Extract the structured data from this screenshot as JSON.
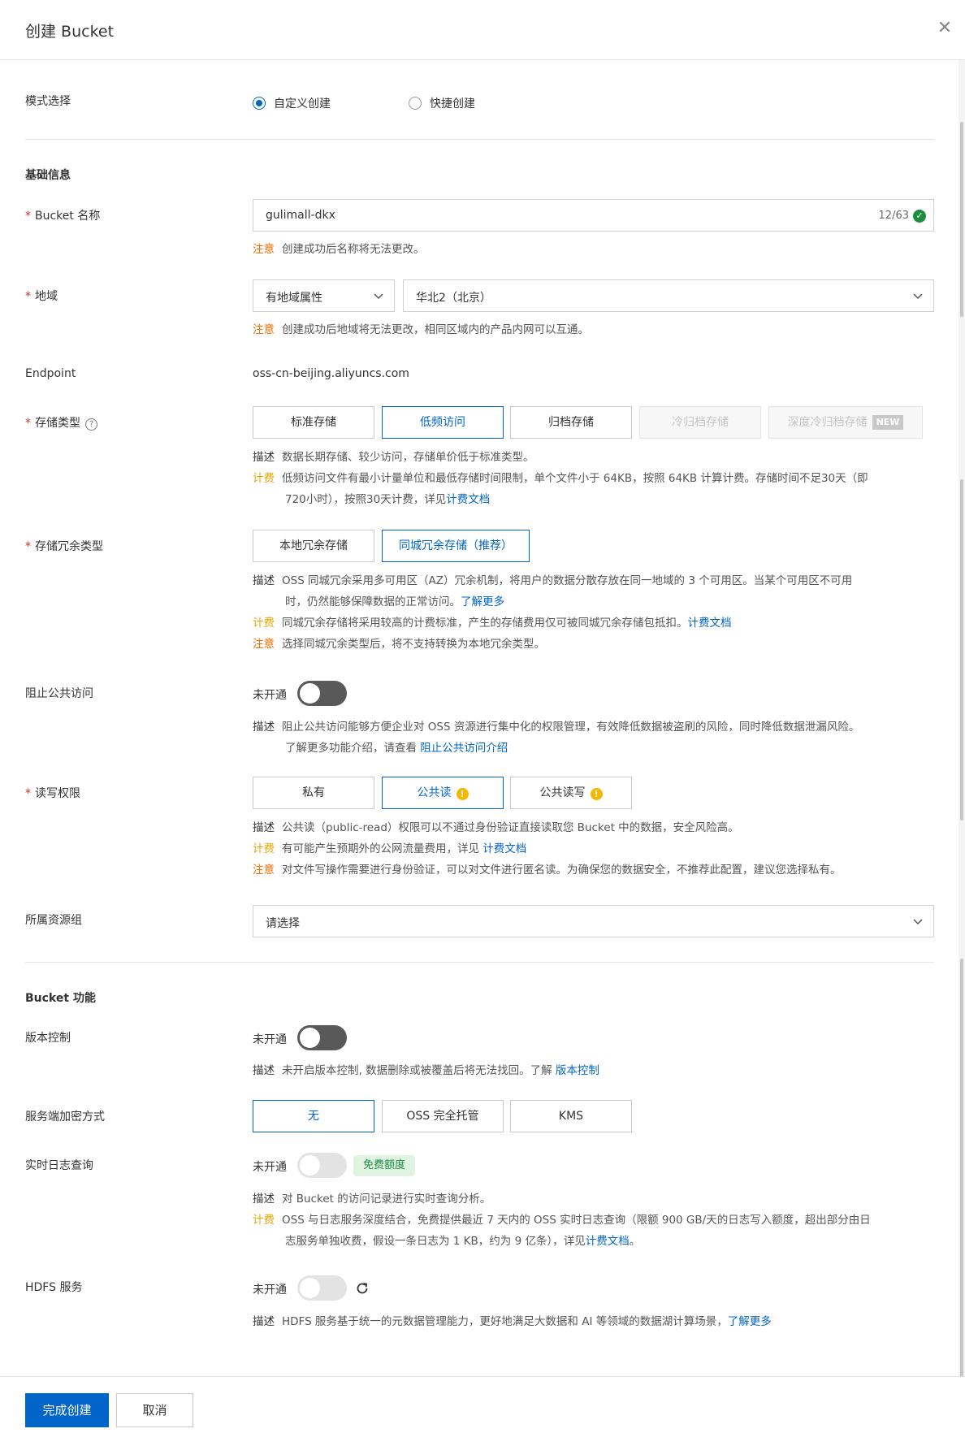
{
  "dialog": {
    "title": "创建 Bucket",
    "close_icon": "close-icon"
  },
  "mode": {
    "label": "模式选择",
    "options": [
      "自定义创建",
      "快捷创建"
    ],
    "selected": "自定义创建"
  },
  "basic_section": {
    "title": "基础信息"
  },
  "bucket_name": {
    "label": "Bucket 名称",
    "value": "gulimall-dkx",
    "counter": "12/63",
    "note_tag": "注意",
    "note": "创建成功后名称将无法更改。"
  },
  "region": {
    "label": "地域",
    "attr_value": "有地域属性",
    "region_value": "华北2（北京）",
    "note_tag": "注意",
    "note": "创建成功后地域将无法更改，相同区域内的产品内网可以互通。"
  },
  "endpoint": {
    "label": "Endpoint",
    "value": "oss-cn-beijing.aliyuncs.com"
  },
  "storage_class": {
    "label": "存储类型",
    "options": [
      "标准存储",
      "低频访问",
      "归档存储",
      "冷归档存储",
      "深度冷归档存储"
    ],
    "new_badge": "NEW",
    "selected": "低频访问",
    "desc_tag": "描述",
    "desc": "数据长期存储、较少访问，存储单价低于标准类型。",
    "fee_tag": "计费",
    "fee_line1": "低频访问文件有最小计量单位和最低存储时间限制，单个文件小于 64KB，按照 64KB 计算计费。存储时间不足30天（即",
    "fee_line2": "720小时），按照30天计费，详见",
    "fee_link": "计费文档"
  },
  "redundancy": {
    "label": "存储冗余类型",
    "options": [
      "本地冗余存储",
      "同城冗余存储（推荐）"
    ],
    "selected": "同城冗余存储（推荐）",
    "desc_tag": "描述",
    "desc_line1": "OSS 同城冗余采用多可用区（AZ）冗余机制，将用户的数据分散存放在同一地域的 3 个可用区。当某个可用区不可用",
    "desc_line2": "时，仍然能够保障数据的正常访问。",
    "desc_link": "了解更多",
    "fee_tag": "计费",
    "fee": "同城冗余存储将采用较高的计费标准，产生的存储费用仅可被同城冗余存储包抵扣。",
    "fee_link": "计费文档",
    "note_tag": "注意",
    "note": "选择同城冗余类型后，将不支持转换为本地冗余类型。"
  },
  "block_public": {
    "label": "阻止公共访问",
    "status": "未开通",
    "desc_tag": "描述",
    "desc_line1": "阻止公共访问能够方便企业对 OSS 资源进行集中化的权限管理，有效降低数据被盗刷的风险，同时降低数据泄漏风险。",
    "desc_line2": "了解更多功能介绍，请查看",
    "desc_link": "阻止公共访问介绍"
  },
  "acl": {
    "label": "读写权限",
    "options": [
      "私有",
      "公共读",
      "公共读写"
    ],
    "selected": "公共读",
    "desc_tag": "描述",
    "desc": "公共读（public-read）权限可以不通过身份验证直接读取您 Bucket 中的数据，安全风险高。",
    "fee_tag": "计费",
    "fee": "有可能产生预期外的公网流量费用，详见",
    "fee_link": "计费文档",
    "note_tag": "注意",
    "note": "对文件写操作需要进行身份验证，可以对文件进行匿名读。为确保您的数据安全，不推荐此配置，建议您选择私有。"
  },
  "resource_group": {
    "label": "所属资源组",
    "placeholder": "请选择"
  },
  "bucket_features": {
    "title": "Bucket 功能"
  },
  "versioning": {
    "label": "版本控制",
    "status": "未开通",
    "desc_tag": "描述",
    "desc": "未开启版本控制, 数据删除或被覆盖后将无法找回。了解",
    "desc_link": "版本控制"
  },
  "encryption": {
    "label": "服务端加密方式",
    "options": [
      "无",
      "OSS 完全托管",
      "KMS"
    ],
    "selected": "无"
  },
  "realtime_log": {
    "label": "实时日志查询",
    "status": "未开通",
    "badge": "免费额度",
    "desc_tag": "描述",
    "desc": "对 Bucket 的访问记录进行实时查询分析。",
    "fee_tag": "计费",
    "fee_line1": "OSS 与日志服务深度结合，免费提供最近 7 天内的 OSS 实时日志查询（限额 900 GB/天的日志写入额度，超出部分由日",
    "fee_line2": "志服务单独收费，假设一条日志为 1 KB，约为 9 亿条），详见",
    "fee_link": "计费文档",
    "fee_end": "。"
  },
  "hdfs": {
    "label": "HDFS 服务",
    "status": "未开通",
    "desc_tag": "描述",
    "desc": "HDFS 服务基于统一的元数据管理能力，更好地满足大数据和 AI 等领域的数据湖计算场景，",
    "desc_link": "了解更多"
  },
  "footer": {
    "confirm": "完成创建",
    "cancel": "取消"
  },
  "colors": {
    "primary": "#0064c8",
    "warn": "#f56c00",
    "fee": "#e6a700",
    "success": "#1e8e3e"
  }
}
